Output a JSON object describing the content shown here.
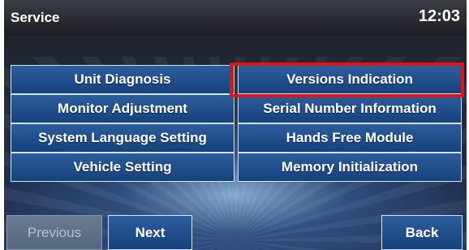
{
  "header": {
    "title": "Service",
    "clock": "12:03"
  },
  "menu": {
    "left": [
      "Unit Diagnosis",
      "Monitor Adjustment",
      "System Language Setting",
      "Vehicle Setting"
    ],
    "right": [
      "Versions Indication",
      "Serial Number Information",
      "Hands Free Module",
      "Memory Initialization"
    ]
  },
  "footer": {
    "previous": "Previous",
    "next": "Next",
    "back": "Back"
  },
  "colors": {
    "highlight": "#e01414",
    "button": "#1f4f8c"
  }
}
